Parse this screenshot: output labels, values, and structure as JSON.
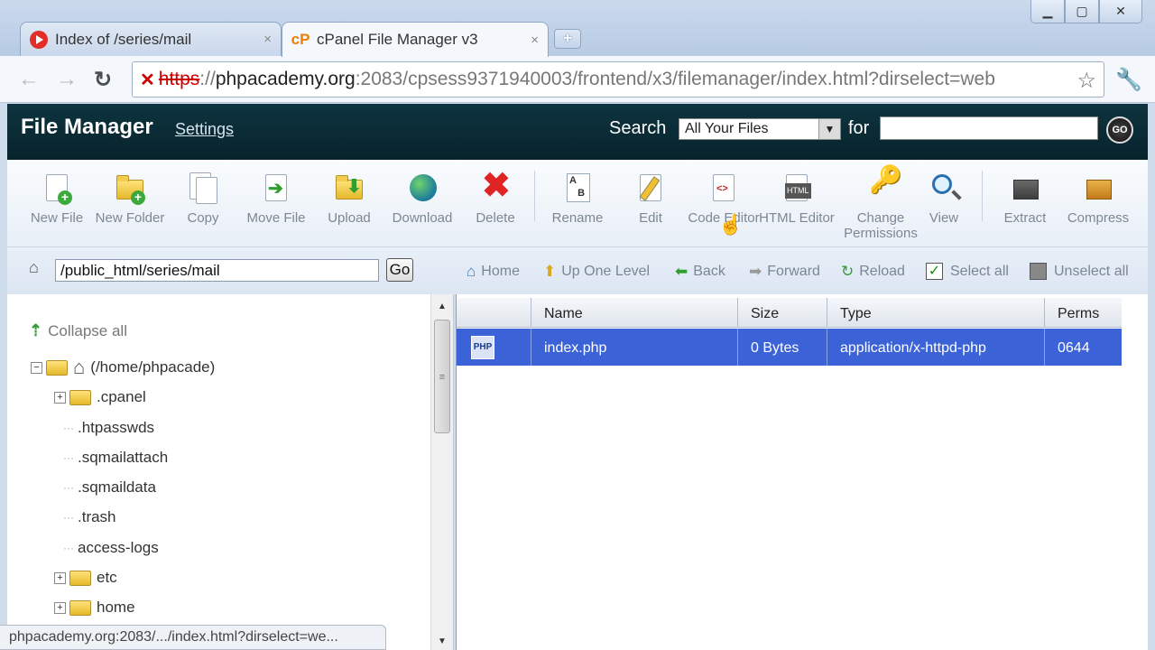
{
  "browser": {
    "tabs": [
      {
        "title": "Index of /series/mail",
        "close": "×",
        "active": false
      },
      {
        "title": "cPanel File Manager v3",
        "close": "×",
        "active": true
      }
    ],
    "favicon_cp": "cP",
    "url": {
      "https": "https",
      "sep": "://",
      "domain": "phpacademy.org",
      "rest": ":2083/cpsess9371940003/frontend/x3/filemanager/index.html?dirselect=web"
    },
    "status_url": "phpacademy.org:2083/.../index.html?dirselect=we..."
  },
  "header": {
    "title": "File Manager",
    "settings": "Settings",
    "search_label": "Search",
    "search_scope": "All Your Files",
    "for_label": "for",
    "go_label": "GO"
  },
  "toolbar": {
    "new_file": "New File",
    "new_folder": "New Folder",
    "copy": "Copy",
    "move_file": "Move File",
    "upload": "Upload",
    "download": "Download",
    "delete": "Delete",
    "rename": "Rename",
    "edit": "Edit",
    "code_editor": "Code Editor",
    "html_editor": "HTML Editor",
    "change_permissions": "Change Permissions",
    "view": "View",
    "extract": "Extract",
    "compress": "Compress"
  },
  "pathbar": {
    "path": "/public_html/series/mail",
    "go": "Go",
    "home": "Home",
    "up_one_level": "Up One Level",
    "back": "Back",
    "forward": "Forward",
    "reload": "Reload",
    "select_all": "Select all",
    "unselect_all": "Unselect all"
  },
  "tree": {
    "collapse_all": "Collapse all",
    "root": "(/home/phpacade)",
    "items": [
      {
        "name": ".cpanel",
        "type": "folder"
      },
      {
        "name": ".htpasswds",
        "type": "item"
      },
      {
        "name": ".sqmailattach",
        "type": "item"
      },
      {
        "name": ".sqmaildata",
        "type": "item"
      },
      {
        "name": ".trash",
        "type": "item"
      },
      {
        "name": "access-logs",
        "type": "item"
      },
      {
        "name": "etc",
        "type": "folder"
      },
      {
        "name": "home",
        "type": "folder"
      }
    ]
  },
  "filelist": {
    "columns": {
      "name": "Name",
      "size": "Size",
      "type": "Type",
      "perms": "Perms"
    },
    "rows": [
      {
        "icon": "PHP",
        "name": "index.php",
        "size": "0 Bytes",
        "type": "application/x-httpd-php",
        "perms": "0644",
        "selected": true
      }
    ]
  },
  "colors": {
    "header_bg": "#07222b",
    "selected_row": "#3b62d6",
    "toolbar_text": "#7d8794"
  }
}
